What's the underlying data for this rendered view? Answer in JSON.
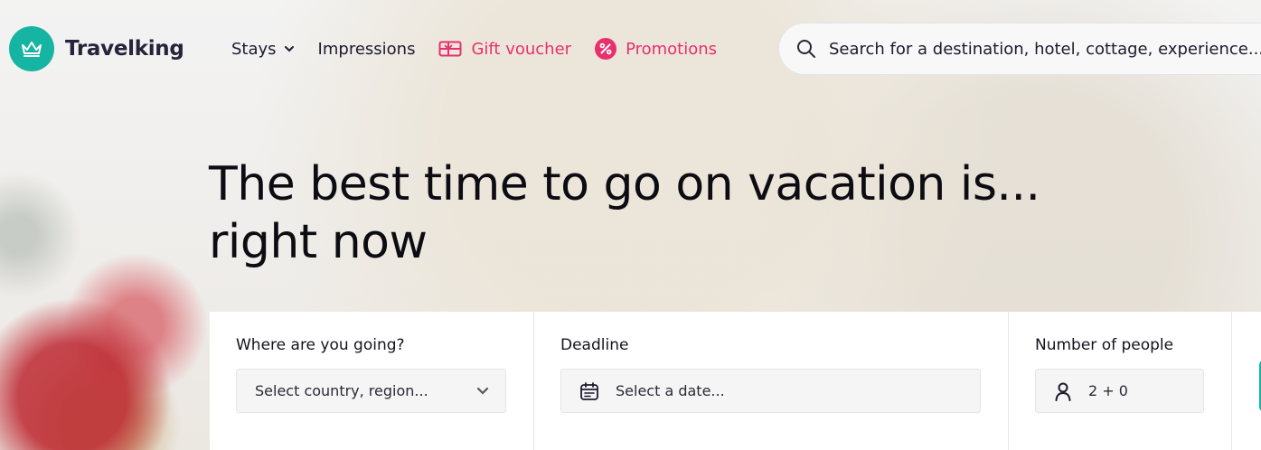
{
  "brand": {
    "name": "Travelking",
    "logo_icon": "crown-icon",
    "accent": "#16b4a2"
  },
  "nav": {
    "stays": "Stays",
    "impressions": "Impressions",
    "gift_voucher": "Gift voucher",
    "promotions": "Promotions",
    "promo_color": "#e8306e"
  },
  "search": {
    "placeholder": "Search for a destination, hotel, cottage, experience..."
  },
  "hero": {
    "title_line1": "The best time to go on vacation is...",
    "title_line2": "right now"
  },
  "booking": {
    "destination": {
      "label": "Where are you going?",
      "placeholder": "Select country, region..."
    },
    "deadline": {
      "label": "Deadline",
      "placeholder": "Select a date..."
    },
    "people": {
      "label": "Number of people",
      "value": "2 + 0"
    }
  }
}
